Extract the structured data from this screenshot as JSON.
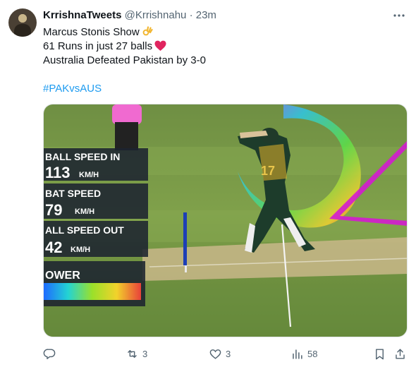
{
  "tweet": {
    "display_name": "KrrishnaTweets",
    "handle": "@Krrishnahu",
    "separator": "·",
    "time": "23m",
    "lines": [
      "Marcus Stonis Show",
      "61 Runs in just 27 balls",
      "Australia Defeated Pakistan by 3-0"
    ],
    "hashtag": "#PAKvsAUS"
  },
  "overlay": {
    "ball_speed_in_label": "BALL SPEED IN",
    "ball_speed_in_value": "113",
    "ball_speed_in_unit": "KM/H",
    "bat_speed_label": "BAT SPEED",
    "bat_speed_value": "79",
    "bat_speed_unit": "KM/H",
    "ball_speed_out_label": "ALL SPEED OUT",
    "ball_speed_out_value": "42",
    "ball_speed_out_unit": "KM/H",
    "power_label": "OWER",
    "jersey_number": "17"
  },
  "actions": {
    "reply_icon": "reply-icon",
    "repost_count": "3",
    "like_count": "3",
    "views_count": "58"
  },
  "colors": {
    "link": "#1d9bf0",
    "secondary_text": "#536471",
    "heart": "#f4212e"
  }
}
